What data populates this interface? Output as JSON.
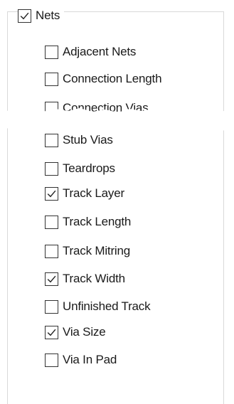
{
  "nets": {
    "label": "Nets",
    "checked": true
  },
  "items": [
    {
      "label": "Adjacent Nets",
      "checked": false
    },
    {
      "label": "Connection Length",
      "checked": false
    },
    {
      "label": "Connection Vias",
      "checked": false
    },
    {
      "label": "Stub Vias",
      "checked": false
    },
    {
      "label": "Teardrops",
      "checked": false
    },
    {
      "label": "Track Layer",
      "checked": true
    },
    {
      "label": "Track Length",
      "checked": false
    },
    {
      "label": "Track Mitring",
      "checked": false
    },
    {
      "label": "Track Width",
      "checked": true
    },
    {
      "label": "Unfinished Track",
      "checked": false
    },
    {
      "label": "Via Size",
      "checked": true
    },
    {
      "label": "Via In Pad",
      "checked": false
    }
  ]
}
